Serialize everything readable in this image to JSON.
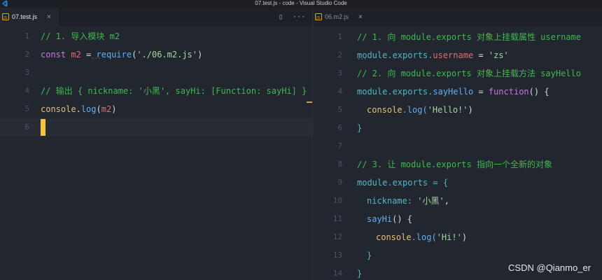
{
  "window": {
    "title": "07.test.js - code - Visual Studio Code"
  },
  "colors": {
    "accent_js": "#e5a00d",
    "cursor": "#f5c542",
    "comment": "#3fb950",
    "background": "#22262e"
  },
  "left_pane": {
    "tab": {
      "filename": "07.test.js",
      "close": "×"
    },
    "actions": {
      "split": "▯",
      "more": "···"
    },
    "lines": [
      {
        "n": "1",
        "text": "// 1. 导入模块 m2"
      },
      {
        "n": "2",
        "kw": "const",
        "var": "m2",
        "eq": " = ",
        "fn": "require",
        "open": "(",
        "str": "'./06.m2.js'",
        "close": ")"
      },
      {
        "n": "3"
      },
      {
        "n": "4",
        "text": "// 输出 { nickname: '小黑', sayHi: [Function: sayHi] }"
      },
      {
        "n": "5",
        "obj": "console",
        "dot": ".",
        "fn": "log",
        "open": "(",
        "var": "m2",
        "close": ")"
      },
      {
        "n": "6"
      }
    ]
  },
  "right_pane": {
    "tab": {
      "filename": "06.m2.js",
      "close": "×"
    },
    "lines": [
      {
        "n": "1",
        "text": "// 1. 向 module.exports 对象上挂载属性 username"
      },
      {
        "n": "2",
        "a": "module.exports.",
        "b": "username",
        "c": " = ",
        "d": "'zs'"
      },
      {
        "n": "3",
        "text": "// 2. 向 module.exports 对象上挂载方法 sayHello"
      },
      {
        "n": "4",
        "a": "module.exports.",
        "b": "sayHello",
        "c": " = ",
        "d": "function",
        "e": "() {"
      },
      {
        "n": "5",
        "a": "console",
        "b": ".log(",
        "c": "'Hello!'",
        "d": ")"
      },
      {
        "n": "6",
        "text": "}"
      },
      {
        "n": "7"
      },
      {
        "n": "8",
        "text": "// 3. 让 module.exports 指向一个全新的对象"
      },
      {
        "n": "9",
        "text": "module.exports = {"
      },
      {
        "n": "10",
        "a": "nickname: ",
        "b": "'小黑'",
        "c": ","
      },
      {
        "n": "11",
        "a": "sayHi",
        "b": "() {"
      },
      {
        "n": "12",
        "a": "console",
        "b": ".log(",
        "c": "'Hi!'",
        "d": ")"
      },
      {
        "n": "13",
        "text": "}"
      },
      {
        "n": "14",
        "text": "}"
      }
    ]
  },
  "watermark": "CSDN @Qianmo_er"
}
